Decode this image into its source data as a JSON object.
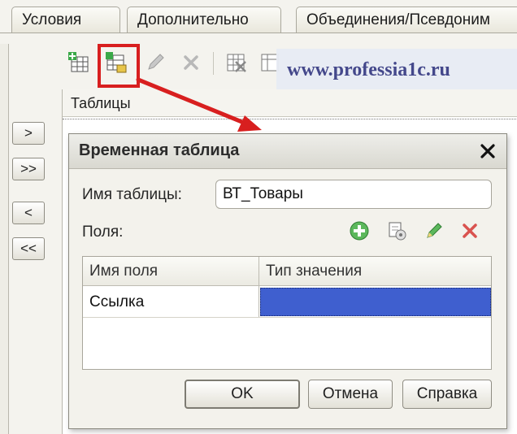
{
  "tabs": [
    {
      "label": "Условия"
    },
    {
      "label": "Дополнительно"
    },
    {
      "label": "Объединения/Псевдоним"
    }
  ],
  "side_buttons": [
    {
      "label": ">"
    },
    {
      "label": ">>"
    },
    {
      "label": "<"
    },
    {
      "label": "<<"
    }
  ],
  "toolbar": {
    "icons": [
      "add-table-icon",
      "add-temp-table-icon",
      "edit-icon",
      "delete-icon",
      "table-copy-icon",
      "table-props-icon"
    ]
  },
  "watermark": "www.professia1c.ru",
  "tables_panel": {
    "header": "Таблицы"
  },
  "dialog": {
    "title": "Временная таблица",
    "name_label": "Имя таблицы:",
    "name_value": "ВТ_Товары",
    "fields_label": "Поля:",
    "icons": [
      "add-icon",
      "copy-icon",
      "edit-icon",
      "delete-icon"
    ],
    "columns": [
      "Имя поля",
      "Тип значения"
    ],
    "rows": [
      {
        "name": "Ссылка",
        "type": ""
      }
    ],
    "buttons": {
      "ok": "OK",
      "cancel": "Отмена",
      "help": "Справка"
    }
  },
  "colors": {
    "highlight": "#d81f1f",
    "selection": "#3f5fcf",
    "watermark_text": "#3b3f86"
  }
}
